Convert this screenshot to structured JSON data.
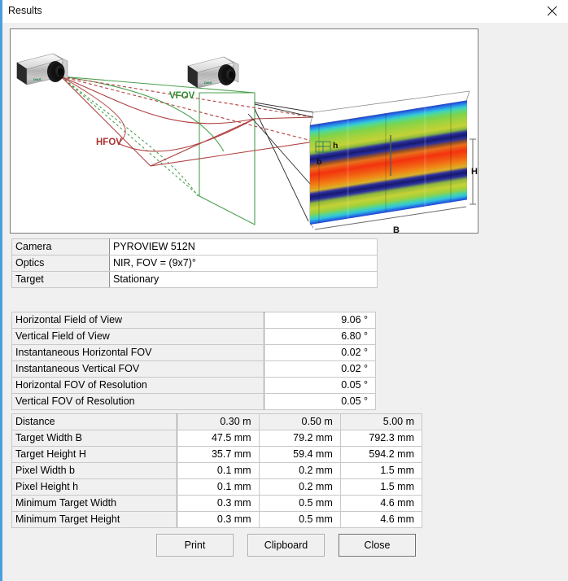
{
  "window": {
    "title": "Results",
    "close_icon": "close-icon",
    "accent_color": "#4a9fe0",
    "background": "#f0f0f0"
  },
  "diagram": {
    "labels": {
      "vfov": "VFOV",
      "hfov": "HFOV",
      "target_width": "B",
      "target_height": "H",
      "pixel_width": "b",
      "pixel_height": "h"
    },
    "colors": {
      "vfov": "#3a8f3e",
      "hfov": "#a83232",
      "ray_black": "#202020"
    }
  },
  "info_table": {
    "rows": [
      {
        "label": "Camera",
        "value": "PYROVIEW 512N"
      },
      {
        "label": "Optics",
        "value": "NIR, FOV = (9x7)°"
      },
      {
        "label": "Target",
        "value": "Stationary"
      }
    ]
  },
  "fov_table": {
    "rows": [
      {
        "label": "Horizontal Field of View",
        "value": "9.06 °"
      },
      {
        "label": "Vertical Field of View",
        "value": "6.80 °"
      },
      {
        "label": "Instantaneous Horizontal FOV",
        "value": "0.02 °"
      },
      {
        "label": "Instantaneous Vertical FOV",
        "value": "0.02 °"
      },
      {
        "label": "Horizontal FOV of Resolution",
        "value": "0.05 °"
      },
      {
        "label": "Vertical FOV of Resolution",
        "value": "0.05 °"
      }
    ]
  },
  "distance_table": {
    "header": {
      "label": "Distance",
      "c1": "0.30 m",
      "c2": "0.50 m",
      "c3": "5.00 m"
    },
    "rows": [
      {
        "label": "Target Width B",
        "c1": "47.5 mm",
        "c2": "79.2 mm",
        "c3": "792.3 mm"
      },
      {
        "label": "Target Height H",
        "c1": "35.7 mm",
        "c2": "59.4 mm",
        "c3": "594.2 mm"
      },
      {
        "label": "Pixel Width b",
        "c1": "0.1 mm",
        "c2": "0.2 mm",
        "c3": "1.5 mm"
      },
      {
        "label": "Pixel Height h",
        "c1": "0.1 mm",
        "c2": "0.2 mm",
        "c3": "1.5 mm"
      },
      {
        "label": "Minimum Target Width",
        "c1": "0.3 mm",
        "c2": "0.5 mm",
        "c3": "4.6 mm"
      },
      {
        "label": "Minimum Target Height",
        "c1": "0.3 mm",
        "c2": "0.5 mm",
        "c3": "4.6 mm"
      }
    ]
  },
  "buttons": {
    "print": "Print",
    "clipboard": "Clipboard",
    "close": "Close"
  }
}
